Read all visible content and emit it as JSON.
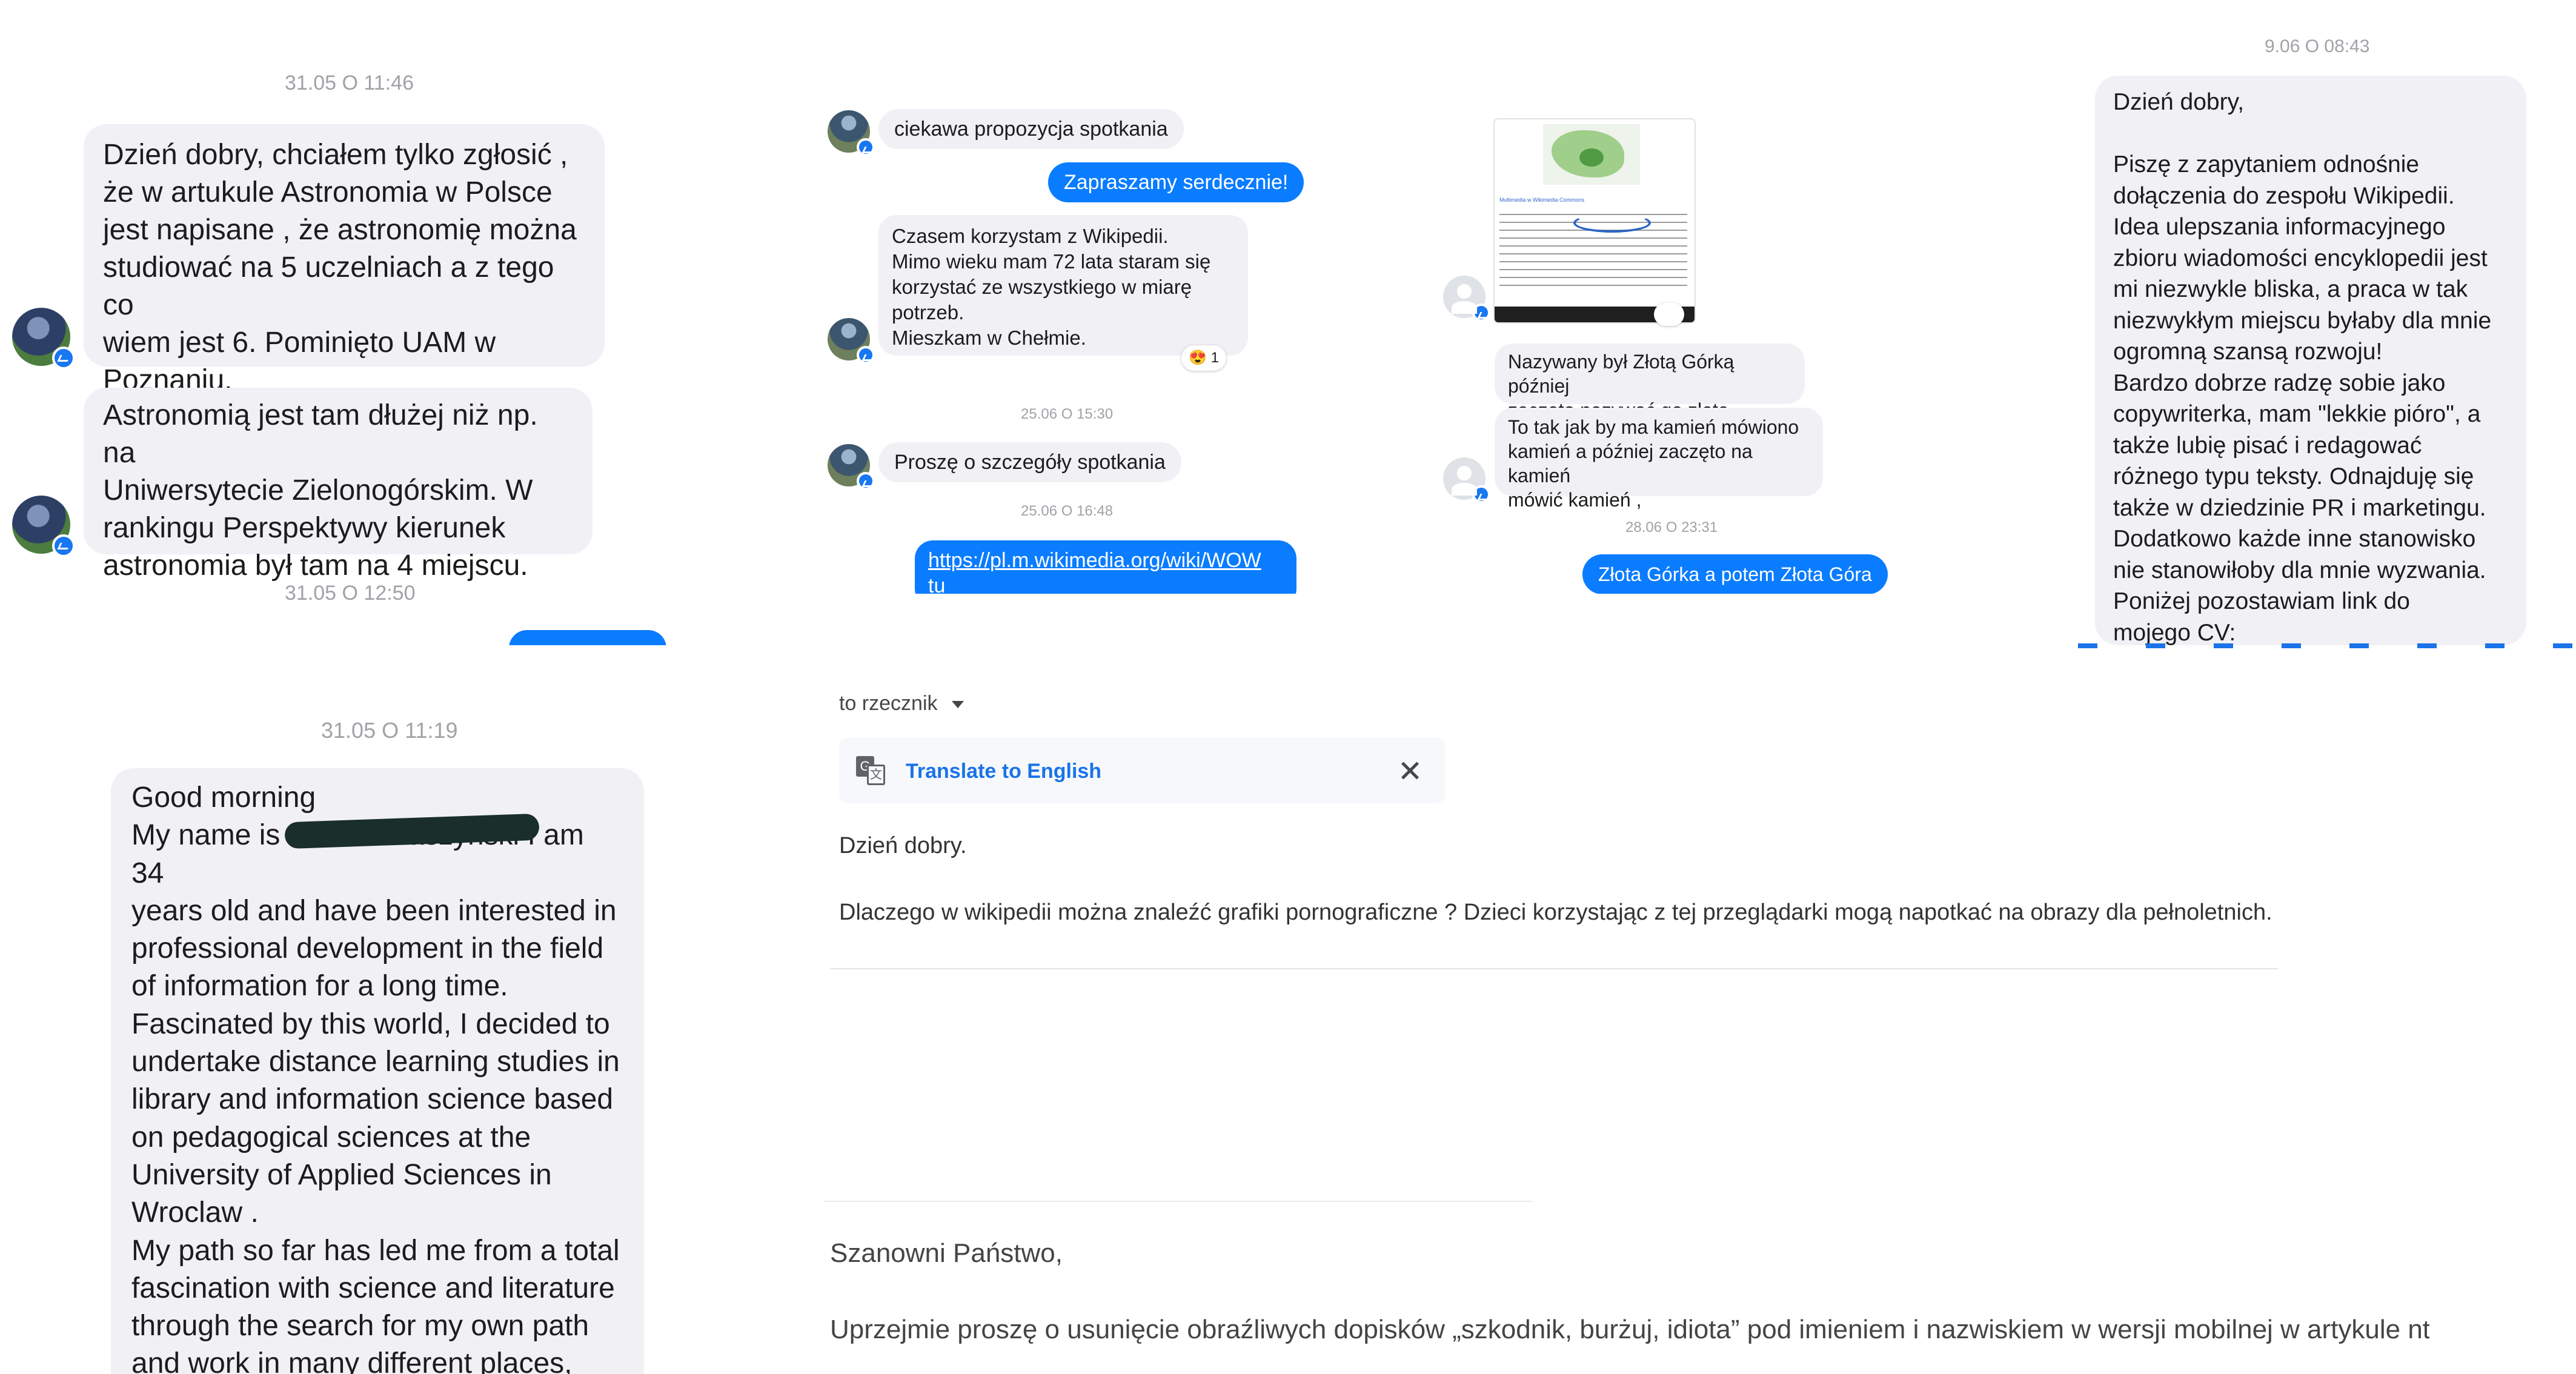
{
  "p1": {
    "ts1": "31.05 O 11:46",
    "msg1": "Dzień dobry, chciałem tylko zgłosić ,\nże w artukule Astronomia w Polsce\njest napisane , że astronomię można\nstudiować na 5 uczelniach a z tego co\nwiem jest 6. Pominięto UAM w\nPoznaniu.",
    "msg2": "Astronomią jest tam dłużej niż np. na\nUniwersytecie Zielonogórskim. W\nrankingu Perspektywy kierunek\nastronomia był tam na 4 miejscu.",
    "ts2": "31.05 O 12:50"
  },
  "p2": {
    "msg1": "ciekawa propozycja spotkania",
    "reply1": "Zapraszamy serdecznie!",
    "msg2": "Czasem korzystam z Wikipedii.\nMimo wieku mam 72 lata staram się\nkorzystać ze wszystkiego w miarę\npotrzeb.\nMieszkam w Chełmie.",
    "reaction_emoji": "😍",
    "reaction_count": "1",
    "ts1": "25.06 O 15:30",
    "msg3": "Proszę o szczegóły spotkania",
    "ts2": "25.06 O 16:48",
    "link": "https://pl.m.wikimedia.org/wiki/WOW",
    "link_tail": " tu\nsą informacje"
  },
  "p3": {
    "msg1": "Nazywany był Złotą Górką później\nzaczęto nazywać go złotą górką?",
    "msg2": "To tak jak by ma kamień mówiono\nkamień a później zaczęto na kamień\nmówić kamień ,",
    "ts1": "28.06 O 23:31",
    "reply1": "Złota Górka a potem Złota Góra",
    "map_title": "Multimedia w Wikimedia Commons"
  },
  "p4": {
    "ts1": "9.06 O 08:43",
    "msg1": "Dzień dobry,\n\nPiszę z zapytaniem odnośnie\ndołączenia do zespołu Wikipedii.\nIdea ulepszania informacyjnego\nzbioru wiadomości encyklopedii jest\nmi niezwykle bliska, a praca w tak\nniezwykłym miejscu byłaby dla mnie\nogromną szansą rozwoju!\nBardzo dobrze radzę sobie jako\ncopywriterka, mam \"lekkie pióro\", a\ntakże lubię pisać i redagować\nróżnego typu teksty. Odnajduję się\ntakże w dziedzinie PR i marketingu.\nDodatkowo każde inne stanowisko\nnie stanowiłoby dla mnie wyzwania.\nPoniżej pozostawiam link do\nmojego CV:"
  },
  "p5": {
    "ts1": "31.05 O 11:19",
    "msg1": "Good morning\nMy name is Michał Ptaszyński I am 34\nyears old and have been interested in\nprofessional development in the field\nof information for a long time.\nFascinated by this world, I decided to\nundertake distance learning studies in\nlibrary and information science based\non pedagogical sciences at the\nUniversity of Applied Sciences in\nWroclaw .\nMy path so far has led me from a total\nfascination with science and literature\nthrough the search for my own path\nand work in many different places,\nboth connected to the book market"
  },
  "p6": {
    "to_label": "to rzecznik",
    "translate_label": "Translate to English",
    "greeting": "Dzień dobry.",
    "body": "Dlaczego w wikipedii można znaleźć grafiki pornograficzne ? Dzieci korzystając z tej przeglądarki mogą napotkać na obrazy dla pełnoletnich."
  },
  "p7": {
    "salutation": "Szanowni Państwo,",
    "body": "Uprzejmie proszę o usunięcie obraźliwych dopisków „szkodnik, burżuj, idiota” pod imieniem i nazwiskiem w wersji mobilnej w artykule nt."
  }
}
